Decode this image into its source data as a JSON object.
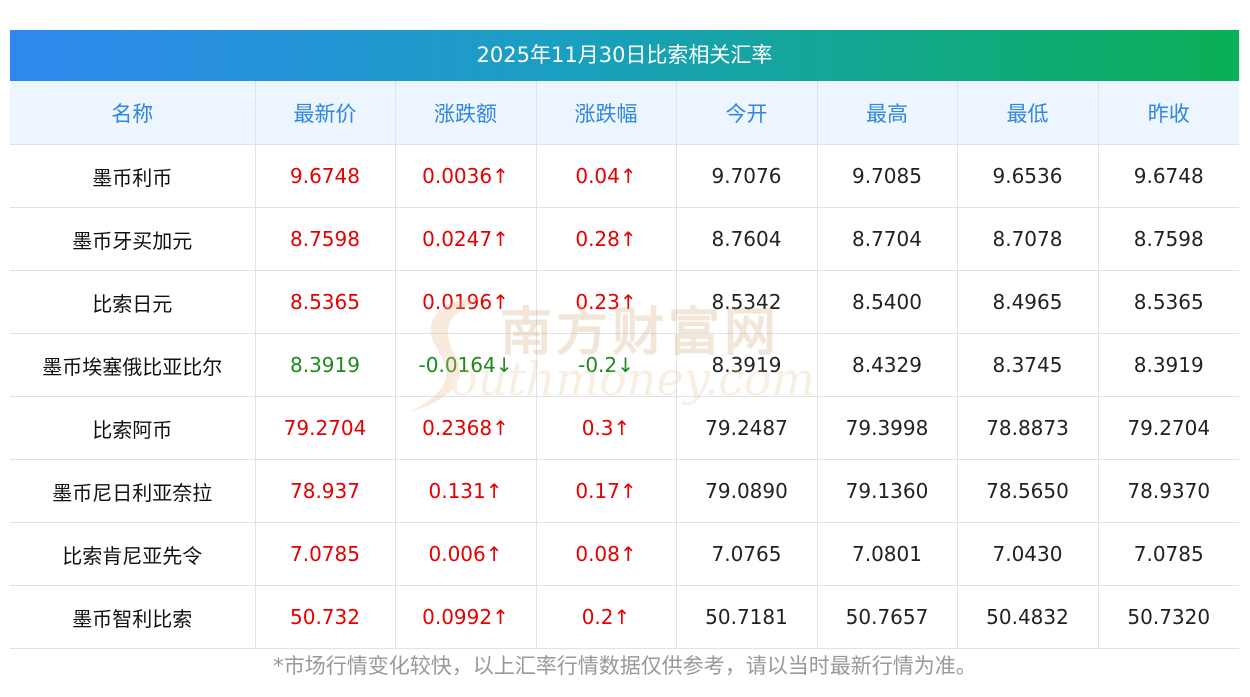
{
  "title": "2025年11月30日比索相关汇率",
  "headers": [
    "名称",
    "最新价",
    "涨跌额",
    "涨跌幅",
    "今开",
    "最高",
    "最低",
    "昨收"
  ],
  "rows": [
    {
      "name": "墨币利币",
      "latest": "9.6748",
      "change": "0.0036↑",
      "pct": "0.04↑",
      "open": "9.7076",
      "high": "9.7085",
      "low": "9.6536",
      "prev": "9.6748",
      "dir": "up"
    },
    {
      "name": "墨币牙买加元",
      "latest": "8.7598",
      "change": "0.0247↑",
      "pct": "0.28↑",
      "open": "8.7604",
      "high": "8.7704",
      "low": "8.7078",
      "prev": "8.7598",
      "dir": "up"
    },
    {
      "name": "比索日元",
      "latest": "8.5365",
      "change": "0.0196↑",
      "pct": "0.23↑",
      "open": "8.5342",
      "high": "8.5400",
      "low": "8.4965",
      "prev": "8.5365",
      "dir": "up"
    },
    {
      "name": "墨币埃塞俄比亚比尔",
      "latest": "8.3919",
      "change": "-0.0164↓",
      "pct": "-0.2↓",
      "open": "8.3919",
      "high": "8.4329",
      "low": "8.3745",
      "prev": "8.3919",
      "dir": "down"
    },
    {
      "name": "比索阿币",
      "latest": "79.2704",
      "change": "0.2368↑",
      "pct": "0.3↑",
      "open": "79.2487",
      "high": "79.3998",
      "low": "78.8873",
      "prev": "79.2704",
      "dir": "up"
    },
    {
      "name": "墨币尼日利亚奈拉",
      "latest": "78.937",
      "change": "0.131↑",
      "pct": "0.17↑",
      "open": "79.0890",
      "high": "79.1360",
      "low": "78.5650",
      "prev": "78.9370",
      "dir": "up"
    },
    {
      "name": "比索肯尼亚先令",
      "latest": "7.0785",
      "change": "0.006↑",
      "pct": "0.08↑",
      "open": "7.0765",
      "high": "7.0801",
      "low": "7.0430",
      "prev": "7.0785",
      "dir": "up"
    },
    {
      "name": "墨币智利比索",
      "latest": "50.732",
      "change": "0.0992↑",
      "pct": "0.2↑",
      "open": "50.7181",
      "high": "50.7657",
      "low": "50.4832",
      "prev": "50.7320",
      "dir": "up"
    }
  ],
  "footnote": "*市场行情变化较快，以上汇率行情数据仅供参考，请以当时最新行情为准。",
  "watermark": {
    "cn": "南方财富网",
    "en": "outhmoney.com"
  },
  "colors": {
    "up": "#e60000",
    "down": "#1d8a1d",
    "header_text": "#3186de",
    "title_grad_start": "#2e88ef",
    "title_grad_end": "#0ab055"
  }
}
